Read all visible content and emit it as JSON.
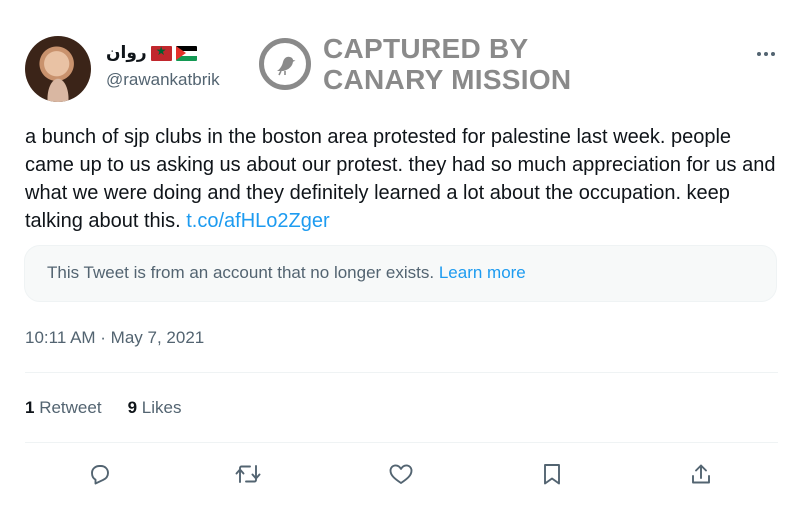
{
  "author": {
    "display_name": "روان",
    "flags": [
      "morocco-flag",
      "palestine-flag"
    ],
    "handle": "@rawankatbrik"
  },
  "watermark": {
    "icon": "canary-bird-icon",
    "line1": "CAPTURED BY",
    "line2": "CANARY MISSION"
  },
  "tweet": {
    "text": "a bunch of sjp clubs in the boston area protested for palestine last week. people came up to us asking us about our protest. they had so much appreciation for us and what we were doing and they definitely learned a lot about the occupation. keep talking about this. ",
    "link": "t.co/afHLo2Zger"
  },
  "notice": {
    "text": "This Tweet is from an account that no longer exists. ",
    "link": "Learn more"
  },
  "timestamp": "10:11 AM · May 7, 2021",
  "stats": {
    "retweets_count": "1",
    "retweets_label": "Retweet",
    "likes_count": "9",
    "likes_label": "Likes"
  },
  "actions": [
    "reply-icon",
    "retweet-icon",
    "like-icon",
    "bookmark-icon",
    "share-icon"
  ],
  "colors": {
    "link": "#1d9bf0",
    "secondary_text": "#536471",
    "watermark": "#8a8a8a"
  }
}
